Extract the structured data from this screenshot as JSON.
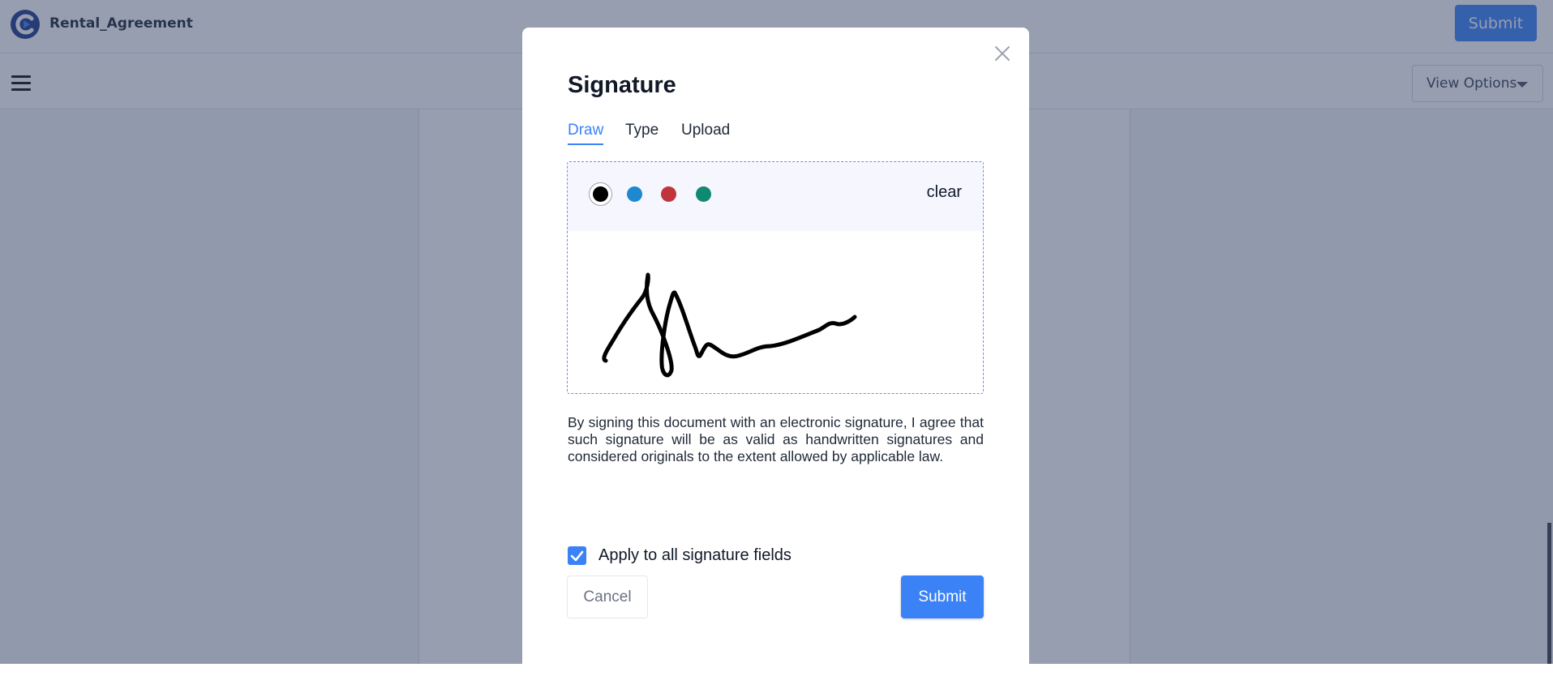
{
  "header": {
    "document_title": "Rental_Agreement",
    "submit_label": "Submit",
    "logo_icon": "brand-logo-icon"
  },
  "toolbar": {
    "menu_icon": "hamburger-menu-icon",
    "view_options_label": "View Options",
    "view_options_icon": "caret-down-icon"
  },
  "modal": {
    "title": "Signature",
    "close_icon": "close-icon",
    "tabs": [
      {
        "label": "Draw",
        "active": true
      },
      {
        "label": "Type",
        "active": false
      },
      {
        "label": "Upload",
        "active": false
      }
    ],
    "pad": {
      "colors": [
        {
          "name": "black",
          "hex": "#000000",
          "selected": true
        },
        {
          "name": "blue",
          "hex": "#1e88d0",
          "selected": false
        },
        {
          "name": "red",
          "hex": "#c0353b",
          "selected": false
        },
        {
          "name": "green",
          "hex": "#0f8a70",
          "selected": false
        }
      ],
      "clear_label": "clear",
      "stroke_color": "#000000"
    },
    "consent_text": "By signing this document with an electronic signature, I agree that such signature will be as valid as handwritten signatures and considered originals to the extent allowed by applicable law.",
    "apply_all": {
      "label": "Apply to all signature fields",
      "checked": true
    },
    "cancel_label": "Cancel",
    "submit_label": "Submit"
  },
  "colors": {
    "accent": "#3b82f6",
    "overlay": "#303e62"
  }
}
